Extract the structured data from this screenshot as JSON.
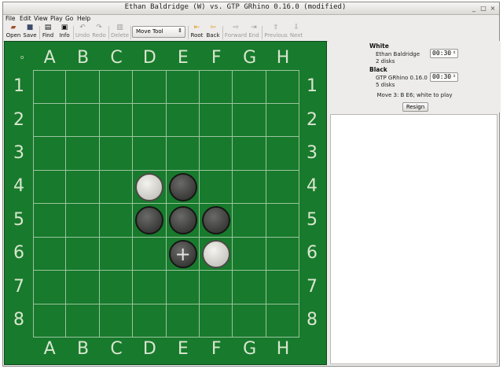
{
  "window": {
    "title": "Ethan Baldridge (W) vs. GTP GRhino 0.16.0 (modified)",
    "controls": [
      "_",
      "□",
      "×"
    ]
  },
  "menubar": [
    "File",
    "Edit",
    "View",
    "Play",
    "Go",
    "Help"
  ],
  "toolbar": {
    "buttons": [
      {
        "label": "Open",
        "icon": "open-icon",
        "enabled": true
      },
      {
        "label": "Save",
        "icon": "save-icon",
        "enabled": true
      },
      {
        "label": "Find",
        "icon": "find-icon",
        "enabled": true
      },
      {
        "label": "Info",
        "icon": "info-icon",
        "enabled": true
      },
      {
        "label": "Undo",
        "icon": "undo-icon",
        "enabled": false
      },
      {
        "label": "Redo",
        "icon": "redo-icon",
        "enabled": false
      },
      {
        "label": "Delete",
        "icon": "delete-icon",
        "enabled": false
      },
      {
        "label": "Root",
        "icon": "root-icon",
        "enabled": true
      },
      {
        "label": "Back",
        "icon": "back-icon",
        "enabled": true
      },
      {
        "label": "Forward",
        "icon": "forward-icon",
        "enabled": false
      },
      {
        "label": "End",
        "icon": "end-icon",
        "enabled": false
      },
      {
        "label": "Previous",
        "icon": "previous-icon",
        "enabled": false
      },
      {
        "label": "Next",
        "icon": "next-icon",
        "enabled": false
      }
    ],
    "tool_select": "Move Tool"
  },
  "board": {
    "columns": [
      "A",
      "B",
      "C",
      "D",
      "E",
      "F",
      "G",
      "H"
    ],
    "rows": [
      "1",
      "2",
      "3",
      "4",
      "5",
      "6",
      "7",
      "8"
    ],
    "corner_mark": "o",
    "stones": [
      {
        "pos": "D4",
        "color": "white"
      },
      {
        "pos": "E4",
        "color": "black"
      },
      {
        "pos": "D5",
        "color": "black"
      },
      {
        "pos": "E5",
        "color": "black"
      },
      {
        "pos": "F5",
        "color": "black"
      },
      {
        "pos": "E6",
        "color": "black",
        "last_move": true
      },
      {
        "pos": "F6",
        "color": "white"
      }
    ],
    "last_move_marker": "+",
    "colors": {
      "felt": "#187a2c",
      "grid": "#9ac49e"
    }
  },
  "players": {
    "white": {
      "heading": "White",
      "name": "Ethan Baldridge",
      "disks": "2 disks",
      "clock": "00:30"
    },
    "black": {
      "heading": "Black",
      "name": "GTP GRhino 0.16.0",
      "disks": "5 disks",
      "clock": "00:30"
    }
  },
  "status": "Move 3: B E6; white to play",
  "resign_label": "Resign"
}
